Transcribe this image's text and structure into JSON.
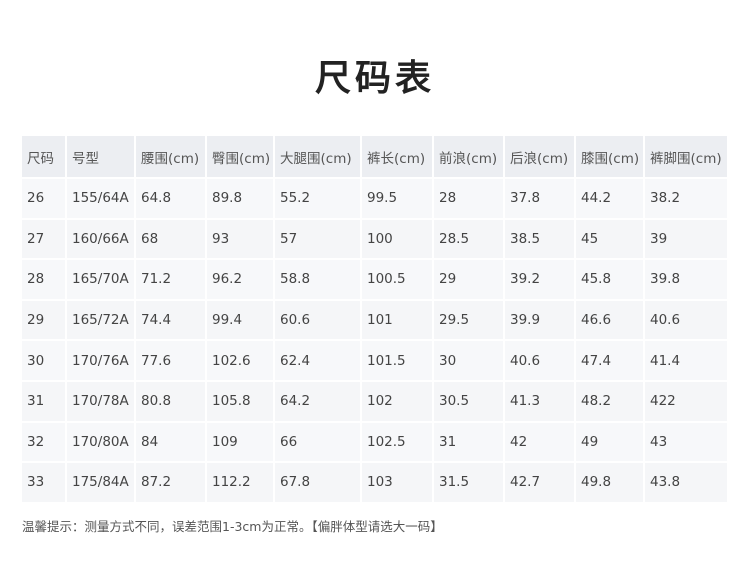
{
  "title": "尺码表",
  "table": {
    "headers": [
      "尺码",
      "号型",
      "腰围(cm)",
      "臀围(cm)",
      "大腿围(cm)",
      "裤长(cm)",
      "前浪(cm)",
      "后浪(cm)",
      "膝围(cm)",
      "裤脚围(cm)"
    ],
    "rows": [
      [
        "26",
        "155/64A",
        "64.8",
        "89.8",
        "55.2",
        "99.5",
        "28",
        "37.8",
        "44.2",
        "38.2"
      ],
      [
        "27",
        "160/66A",
        "68",
        "93",
        "57",
        "100",
        "28.5",
        "38.5",
        "45",
        "39"
      ],
      [
        "28",
        "165/70A",
        "71.2",
        "96.2",
        "58.8",
        "100.5",
        "29",
        "39.2",
        "45.8",
        "39.8"
      ],
      [
        "29",
        "165/72A",
        "74.4",
        "99.4",
        "60.6",
        "101",
        "29.5",
        "39.9",
        "46.6",
        "40.6"
      ],
      [
        "30",
        "170/76A",
        "77.6",
        "102.6",
        "62.4",
        "101.5",
        "30",
        "40.6",
        "47.4",
        "41.4"
      ],
      [
        "31",
        "170/78A",
        "80.8",
        "105.8",
        "64.2",
        "102",
        "30.5",
        "41.3",
        "48.2",
        "422"
      ],
      [
        "32",
        "170/80A",
        "84",
        "109",
        "66",
        "102.5",
        "31",
        "42",
        "49",
        "43"
      ],
      [
        "33",
        "175/84A",
        "87.2",
        "112.2",
        "67.8",
        "103",
        "31.5",
        "42.7",
        "49.8",
        "43.8"
      ]
    ]
  },
  "note": "温馨提示：测量方式不同，误差范围1-3cm为正常。【偏胖体型请选大一码】"
}
